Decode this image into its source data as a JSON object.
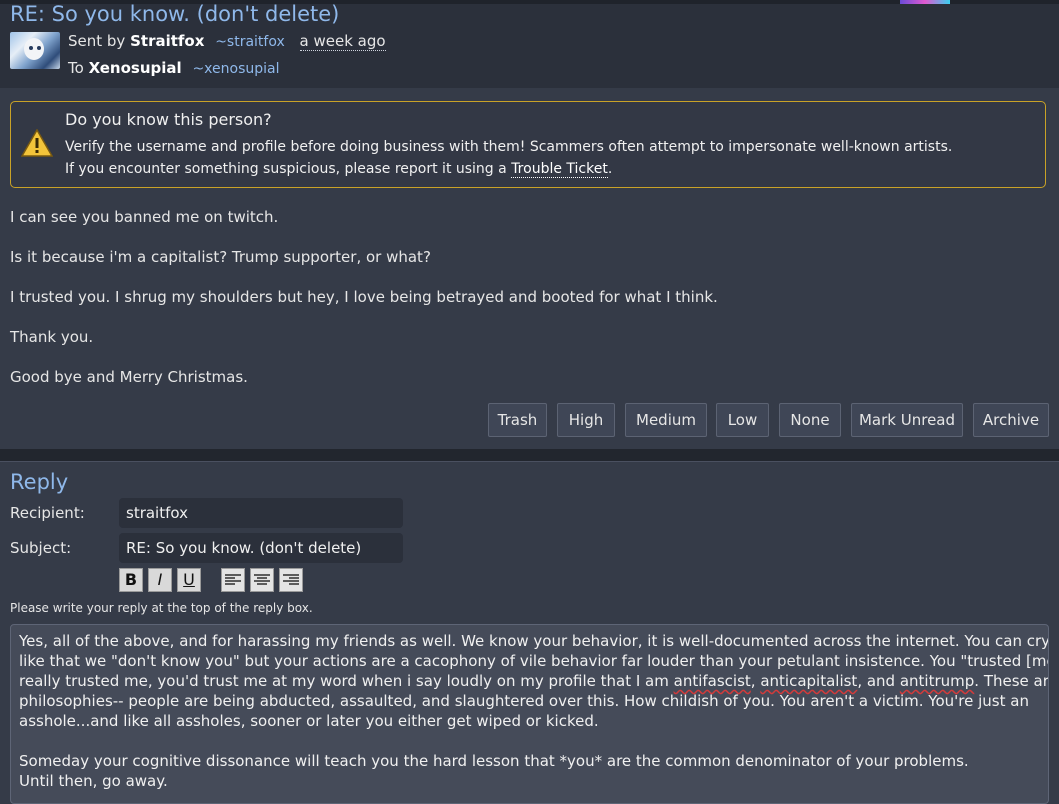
{
  "message": {
    "title": "RE: So you know. (don't delete)",
    "sent_by_prefix": "Sent by",
    "sender_name": "Straitfox",
    "sender_handle": "~straitfox",
    "sent_time": "a week ago",
    "to_prefix": "To",
    "recipient_name": "Xenosupial",
    "recipient_handle": "~xenosupial"
  },
  "warning": {
    "heading": "Do you know this person?",
    "line1": "Verify the username and profile before doing business with them! Scammers often attempt to impersonate well-known artists.",
    "line2_prefix": "If you encounter something suspicious, please report it using a ",
    "link": "Trouble Ticket",
    "line2_suffix": "."
  },
  "body": [
    "I can see you banned me on twitch.",
    "Is it because i'm a capitalist? Trump supporter, or what?",
    "I trusted you. I shrug my shoulders but hey, I love being betrayed and booted for what I think.",
    "Thank you.",
    "Good bye and Merry Christmas."
  ],
  "actions": [
    "Trash",
    "High",
    "Medium",
    "Low",
    "None",
    "Mark Unread",
    "Archive"
  ],
  "reply": {
    "heading": "Reply",
    "recipient_label": "Recipient:",
    "recipient_value": "straitfox",
    "subject_label": "Subject:",
    "subject_value": "RE: So you know.  (don't delete)",
    "toolbar": {
      "bold": "B",
      "italic": "I",
      "underline": "U"
    },
    "hint": "Please write your reply at the top of the reply box.",
    "text_lines": [
      "Yes, all of the above, and for harassing my friends as well. We know your behavior, it is well-documented across the internet. You can cry all you",
      "like that we \"don't know you\" but your actions are a cacophony of vile behavior far louder than your petulant insistence. You \"trusted [me]\"? If you",
      "really trusted me, you'd trust me at my word when i say loudly on my profile that I am antifascist, anticapitalist, and antitrump. These aren't vague",
      "philosophies-- people are being abducted, assaulted, and slaughtered over this. How childish of you. You aren't a victim. You're just an",
      "asshole...and like all assholes, sooner or later you either get wiped or kicked.",
      "",
      "Someday your cognitive dissonance will teach you the hard lesson that *you* are the common denominator of your problems.",
      "Until then, go away."
    ]
  },
  "colors": {
    "accent": "#8fb8ea",
    "warning_border": "#c9a227",
    "background": "#353b48"
  }
}
